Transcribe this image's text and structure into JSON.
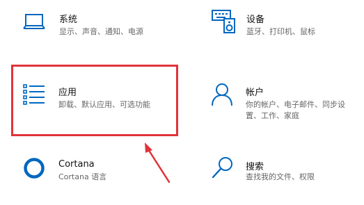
{
  "tiles": {
    "system": {
      "title": "系统",
      "desc": [
        "显示、声音、通知、电源"
      ],
      "icon": "laptop-icon"
    },
    "devices": {
      "title": "设备",
      "desc": [
        "蓝牙、打印机、鼠标"
      ],
      "icon": "keyboard-devices-icon"
    },
    "apps": {
      "title": "应用",
      "desc": [
        "卸载、默认应用、可选功能"
      ],
      "icon": "apps-list-icon"
    },
    "accounts": {
      "title": "帐户",
      "desc": [
        "你的帐户、电子邮件、同步设",
        "置、工作、家庭"
      ],
      "icon": "person-icon"
    },
    "cortana": {
      "title": "Cortana",
      "desc": [
        "Cortana 语言"
      ],
      "icon": "cortana-ring-icon"
    },
    "search": {
      "title": "搜索",
      "desc": [
        "查找我的文件、权限"
      ],
      "icon": "search-icon"
    }
  },
  "colors": {
    "accent": "#0067c0",
    "highlight": "#e0333a"
  }
}
